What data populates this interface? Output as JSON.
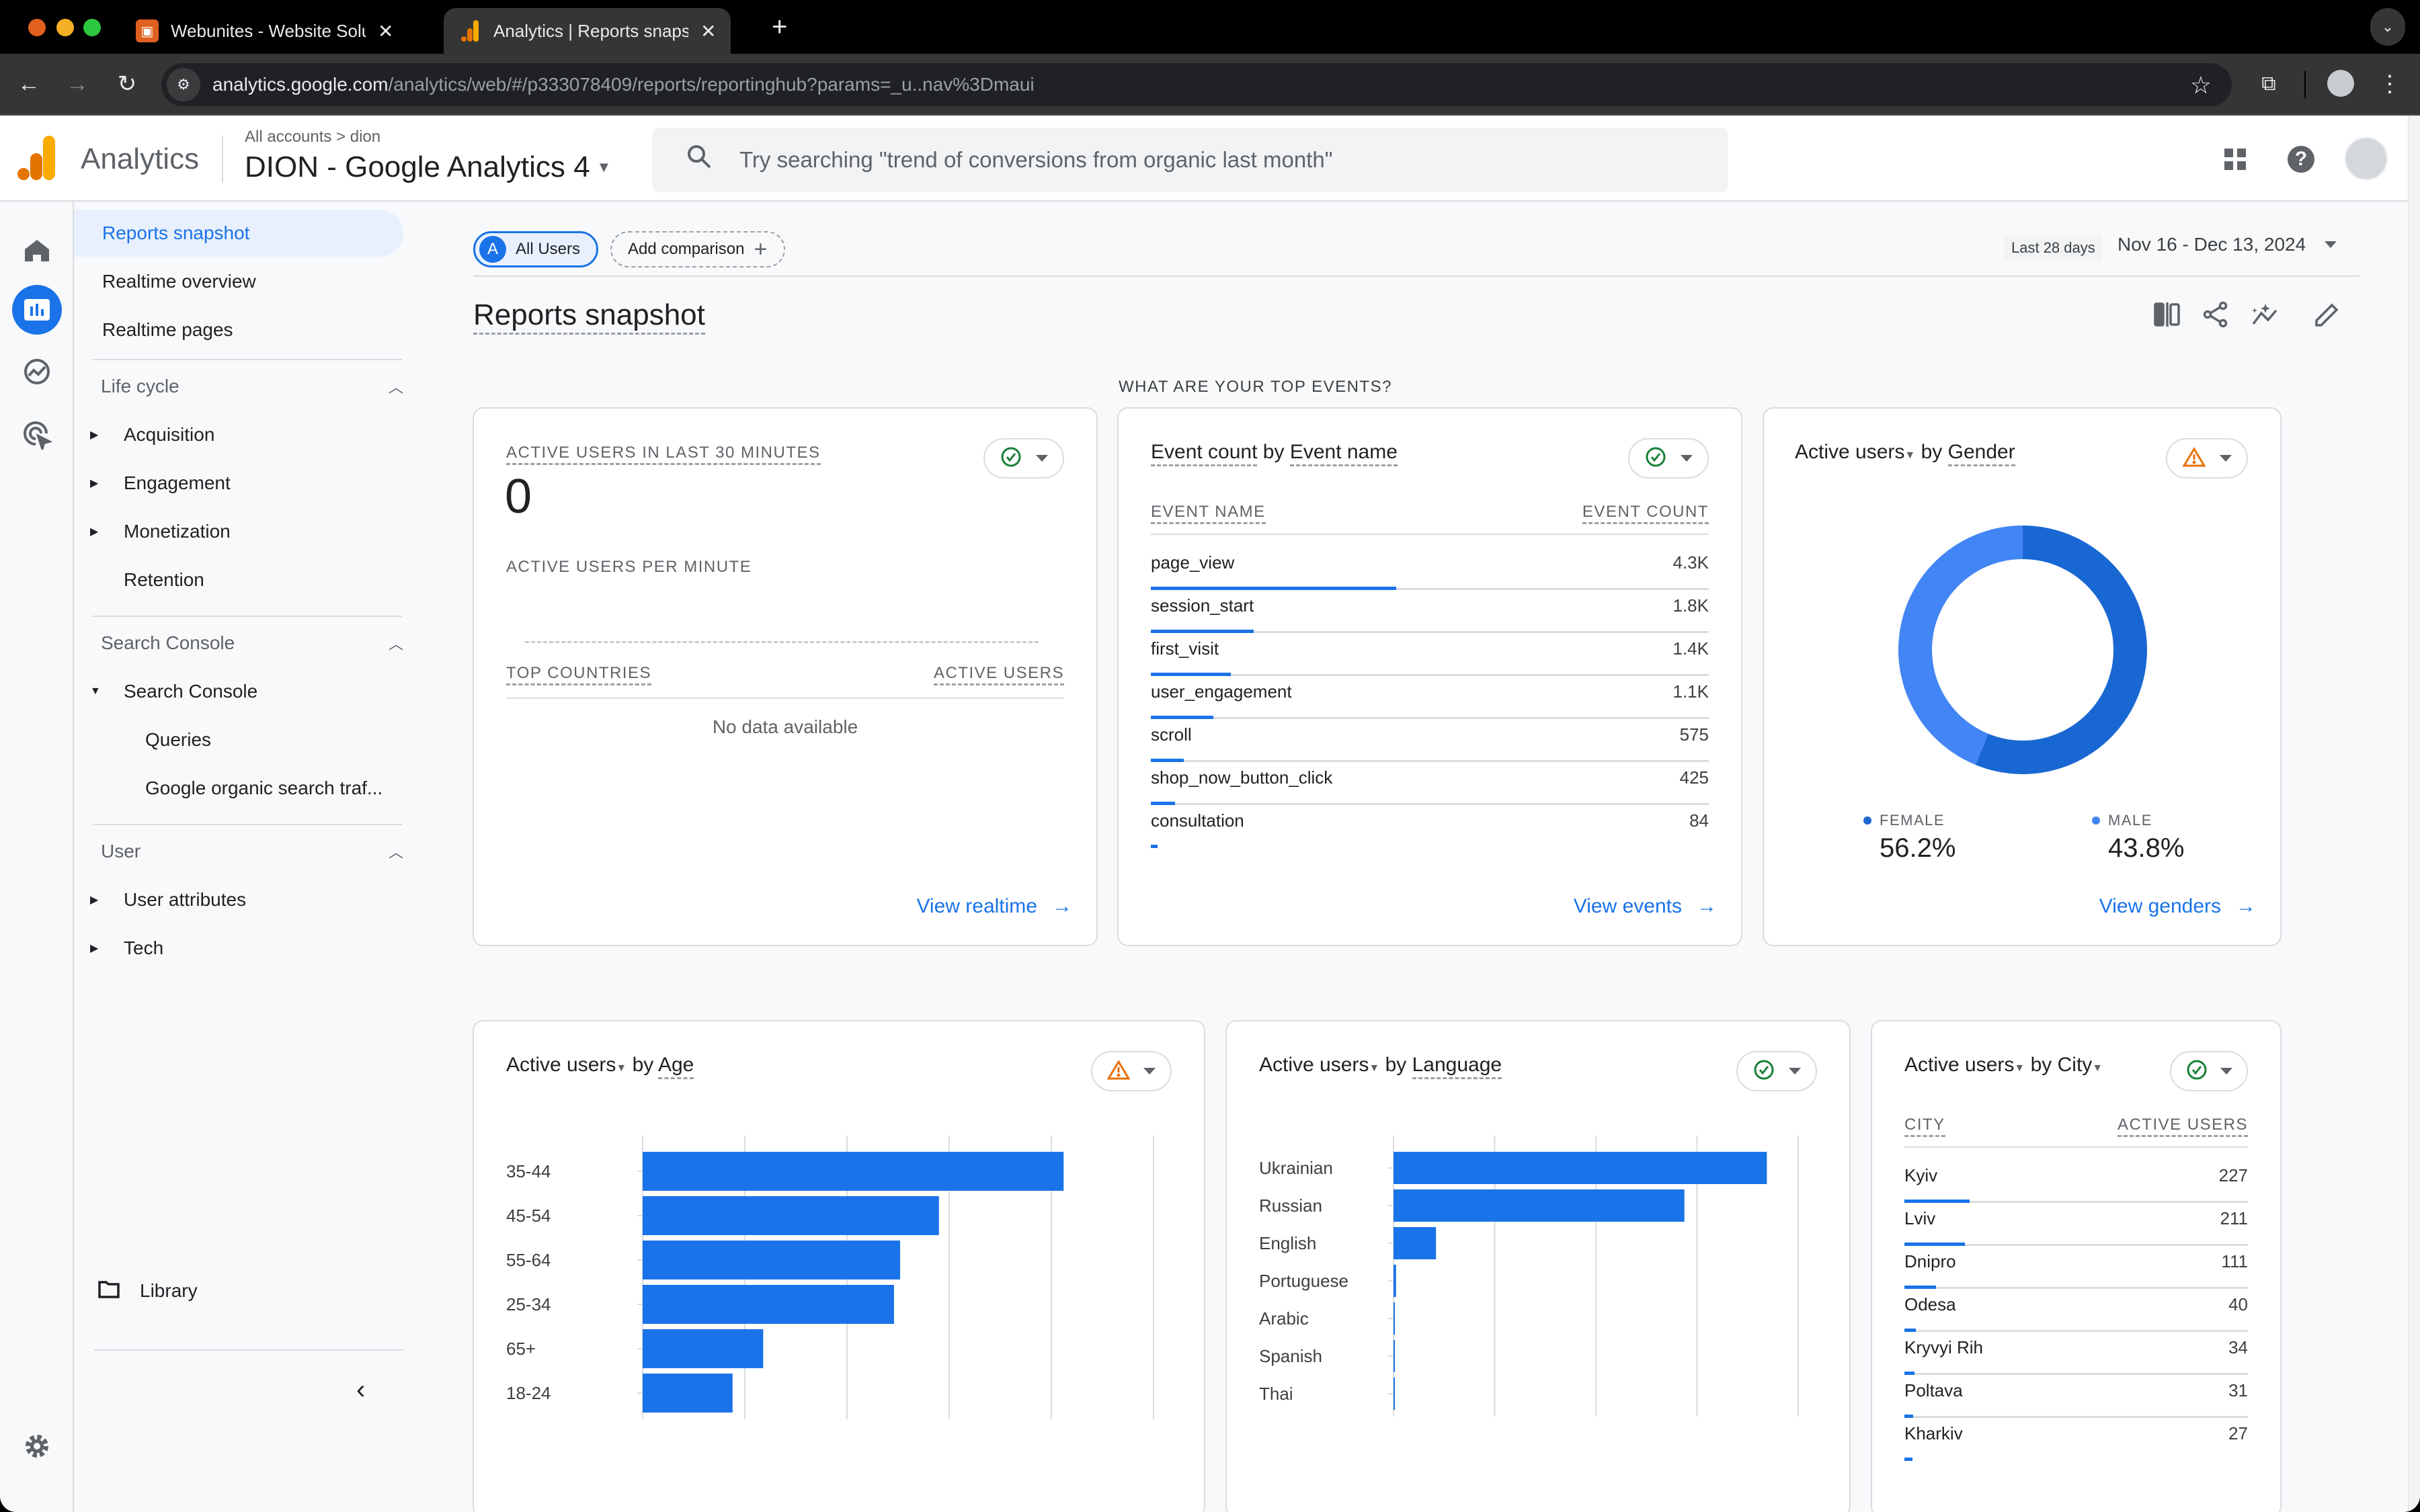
{
  "browser": {
    "tabs": [
      {
        "title": "Webunites - Website Solution",
        "active": false
      },
      {
        "title": "Analytics | Reports snapshot",
        "active": true
      }
    ],
    "url_host": "analytics.google.com",
    "url_path": "/analytics/web/#/p333078409/reports/reportinghub?params=_u..nav%3Dmaui"
  },
  "header": {
    "brand": "Analytics",
    "breadcrumb": "All accounts > dion",
    "property": "DION - Google Analytics 4",
    "search_placeholder": "Try searching \"trend of conversions from organic last month\""
  },
  "sidebar": {
    "top_items": [
      "Reports snapshot",
      "Realtime overview",
      "Realtime pages"
    ],
    "sections": [
      {
        "title": "Life cycle",
        "items": [
          "Acquisition",
          "Engagement",
          "Monetization",
          "Retention"
        ]
      },
      {
        "title": "Search Console",
        "items": [
          "Search Console",
          "Queries",
          "Google organic search traf..."
        ]
      },
      {
        "title": "User",
        "items": [
          "User attributes",
          "Tech"
        ]
      }
    ],
    "library": "Library"
  },
  "toolbar": {
    "segment_badge": "A",
    "segment": "All Users",
    "add_comparison": "Add comparison",
    "date_preset": "Last 28 days",
    "date_range": "Nov 16 - Dec 13, 2024"
  },
  "page": {
    "title": "Reports snapshot",
    "section_label": "WHAT ARE YOUR TOP EVENTS?"
  },
  "realtime_card": {
    "title": "ACTIVE USERS IN LAST 30 MINUTES",
    "value": "0",
    "per_minute_label": "ACTIVE USERS PER MINUTE",
    "col1": "TOP COUNTRIES",
    "col2": "ACTIVE USERS",
    "empty": "No data available",
    "link": "View realtime"
  },
  "events_card": {
    "metric": "Event count",
    "by": "by",
    "dimension": "Event name",
    "col1": "EVENT NAME",
    "col2": "EVENT COUNT",
    "rows": [
      {
        "name": "page_view",
        "value": "4.3K",
        "n": 4300
      },
      {
        "name": "session_start",
        "value": "1.8K",
        "n": 1800
      },
      {
        "name": "first_visit",
        "value": "1.4K",
        "n": 1400
      },
      {
        "name": "user_engagement",
        "value": "1.1K",
        "n": 1100
      },
      {
        "name": "scroll",
        "value": "575",
        "n": 575
      },
      {
        "name": "shop_now_button_click",
        "value": "425",
        "n": 425
      },
      {
        "name": "consultation",
        "value": "84",
        "n": 84
      }
    ],
    "link": "View events"
  },
  "gender_card": {
    "metric": "Active users",
    "by": "by",
    "dimension": "Gender",
    "link": "View genders"
  },
  "age_card": {
    "metric": "Active users",
    "by": "by",
    "dimension": "Age"
  },
  "language_card": {
    "metric": "Active users",
    "by": "by",
    "dimension": "Language"
  },
  "city_card": {
    "metric": "Active users",
    "by": "by",
    "dimension": "City",
    "col1": "CITY",
    "col2": "ACTIVE USERS",
    "rows": [
      {
        "name": "Kyiv",
        "value": "227",
        "n": 227
      },
      {
        "name": "Lviv",
        "value": "211",
        "n": 211
      },
      {
        "name": "Dnipro",
        "value": "111",
        "n": 111
      },
      {
        "name": "Odesa",
        "value": "40",
        "n": 40
      },
      {
        "name": "Kryvyi Rih",
        "value": "34",
        "n": 34
      },
      {
        "name": "Poltava",
        "value": "31",
        "n": 31
      },
      {
        "name": "Kharkiv",
        "value": "27",
        "n": 27
      }
    ]
  },
  "colors": {
    "accent": "#1a73e8",
    "donut_male": "#4285f4",
    "donut_female": "#1967d2",
    "warning": "#e8710a",
    "ok": "#188038"
  },
  "chart_data": [
    {
      "type": "pie",
      "title": "Active users by Gender",
      "categories": [
        "FEMALE",
        "MALE"
      ],
      "values": [
        56.2,
        43.8
      ],
      "labels": [
        "56.2%",
        "43.8%"
      ],
      "legend": "bottom"
    },
    {
      "type": "bar",
      "orientation": "horizontal",
      "title": "Active users by Age",
      "categories": [
        "35-44",
        "45-54",
        "55-64",
        "25-34",
        "65+",
        "18-24"
      ],
      "values": [
        206,
        145,
        126,
        123,
        59,
        44
      ],
      "xlim": [
        0,
        250
      ],
      "xticks": [
        0,
        50,
        100,
        150,
        200,
        250
      ],
      "grid": true
    },
    {
      "type": "bar",
      "orientation": "horizontal",
      "title": "Active users by Language",
      "categories": [
        "Ukrainian",
        "Russian",
        "English",
        "Portuguese",
        "Arabic",
        "Spanish",
        "Thai"
      ],
      "values": [
        738,
        575,
        84,
        5,
        2,
        2,
        1
      ],
      "xlim": [
        0,
        800
      ],
      "xticks": [
        0,
        200,
        400,
        600,
        800
      ],
      "grid": true
    }
  ]
}
